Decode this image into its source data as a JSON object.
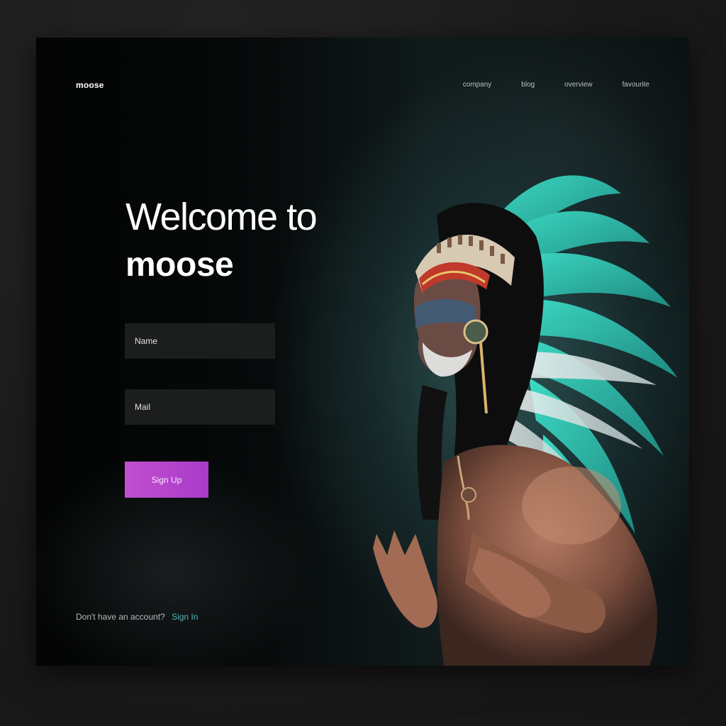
{
  "brand": {
    "name": "moose"
  },
  "nav": {
    "items": [
      {
        "label": "company"
      },
      {
        "label": "blog"
      },
      {
        "label": "overview"
      },
      {
        "label": "favourite"
      }
    ]
  },
  "hero": {
    "line1": "Welcome to",
    "line2": "moose"
  },
  "form": {
    "name_placeholder": "Name",
    "mail_placeholder": "Mail",
    "submit_label": "Sign Up"
  },
  "footer": {
    "prompt": "Don't have an account?",
    "signin_label": "Sign In"
  },
  "colors": {
    "accent": "#b845cd",
    "link": "#52b7bf",
    "background": "#050707",
    "feather": "#3fd3c0"
  },
  "image": {
    "subject": "man with feathered headdress"
  }
}
